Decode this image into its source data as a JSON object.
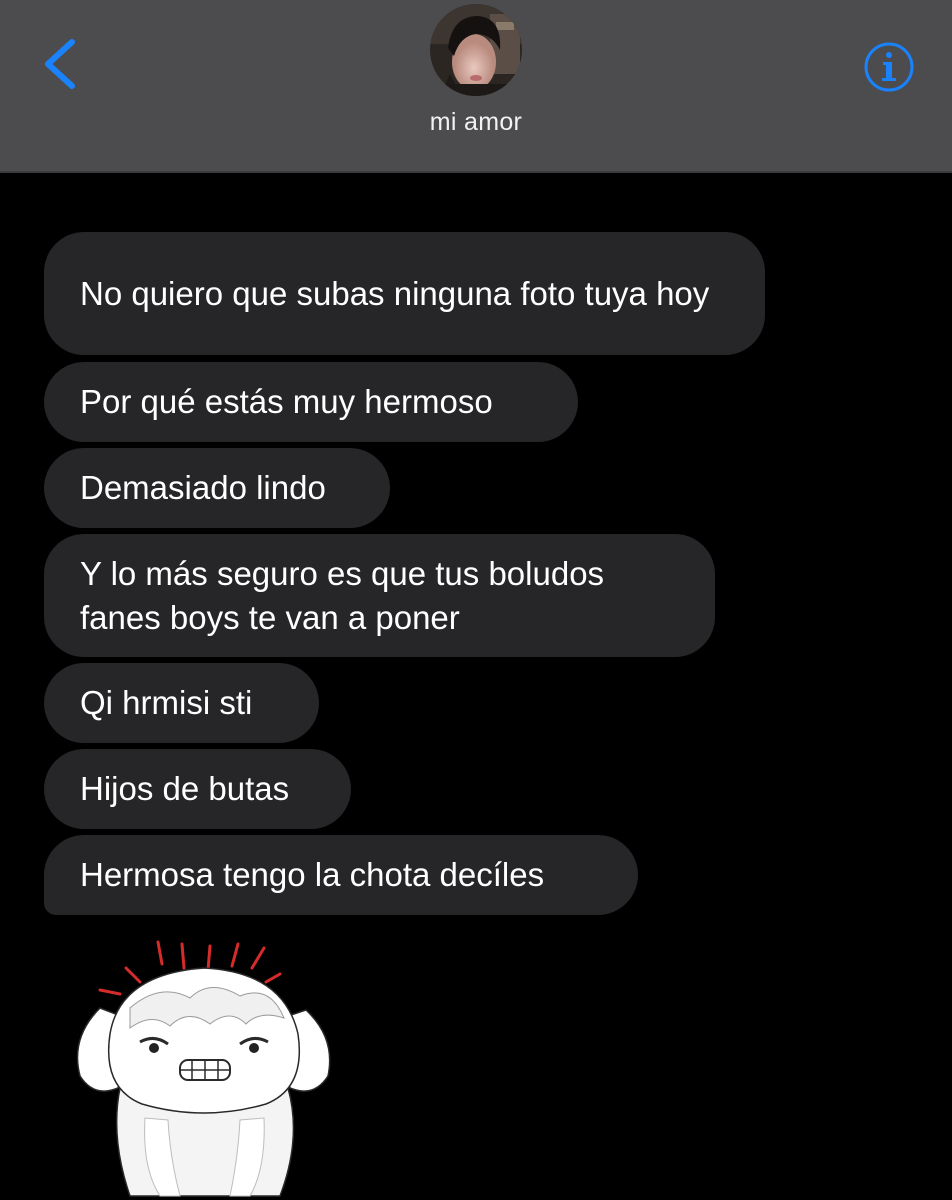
{
  "header": {
    "contact_name": "mi amor",
    "back_icon": "chevron-left-icon",
    "info_icon": "info-circle-icon",
    "accent_color": "#1a82fb",
    "background_color": "#4c4c4e"
  },
  "messages": [
    {
      "sender": "contact",
      "text": "No quiero que subas ninguna foto tuya hoy"
    },
    {
      "sender": "contact",
      "text": "Por qué estás muy hermoso"
    },
    {
      "sender": "contact",
      "text": "Demasiado lindo"
    },
    {
      "sender": "contact",
      "text": "Y lo más seguro es que tus boludos fanes boys te van a poner"
    },
    {
      "sender": "contact",
      "text": "Qi hrmisi sti"
    },
    {
      "sender": "contact",
      "text": "Hijos de butas"
    },
    {
      "sender": "contact",
      "text": "Hermosa tengo la chota decíles"
    }
  ],
  "sticker": {
    "icon": "angry-fluffy-dog-sticker-icon"
  }
}
